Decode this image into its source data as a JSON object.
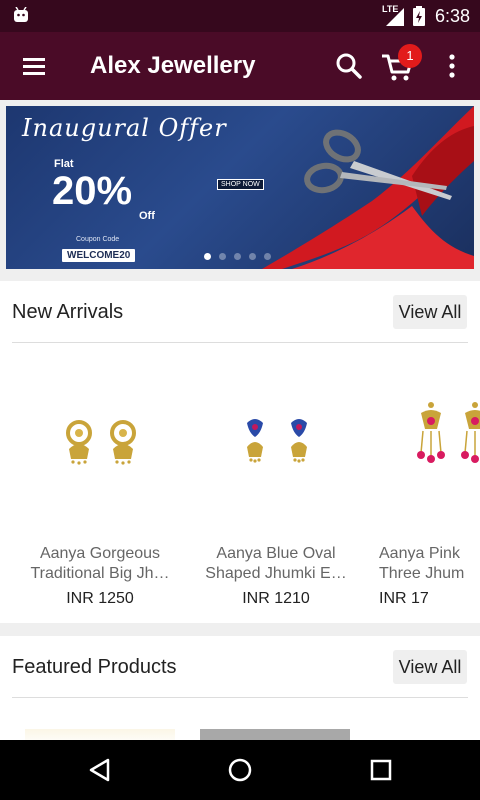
{
  "status_bar": {
    "network": "LTE",
    "time": "6:38"
  },
  "app_bar": {
    "title": "Alex Jewellery",
    "cart_count": "1"
  },
  "banner": {
    "headline": "Inaugural Offer",
    "flat": "Flat",
    "discount": "20%",
    "off": "Off",
    "coupon_label": "Coupon Code",
    "coupon_code": "WELCOME20",
    "cta": "SHOP NOW",
    "slides": 5,
    "active_slide": 1
  },
  "new_arrivals": {
    "title": "New Arrivals",
    "view_all": "View All",
    "products": [
      {
        "name_line1": "Aanya Gorgeous",
        "name_line2": "Traditional Big Jh…",
        "price": "INR 1250"
      },
      {
        "name_line1": "Aanya Blue Oval",
        "name_line2": "Shaped Jhumki E…",
        "price": "INR 1210"
      },
      {
        "name_line1": "Aanya Pink",
        "name_line2": "Three Jhum",
        "price": "INR 17"
      }
    ]
  },
  "featured": {
    "title": "Featured Products",
    "view_all": "View All"
  },
  "colors": {
    "status_bar": "#36081d",
    "app_bar": "#4a0b27",
    "badge": "#e21b1b"
  },
  "icons": [
    "menu-icon",
    "search-icon",
    "cart-icon",
    "overflow-menu-icon",
    "back-icon",
    "home-icon",
    "recents-icon"
  ]
}
